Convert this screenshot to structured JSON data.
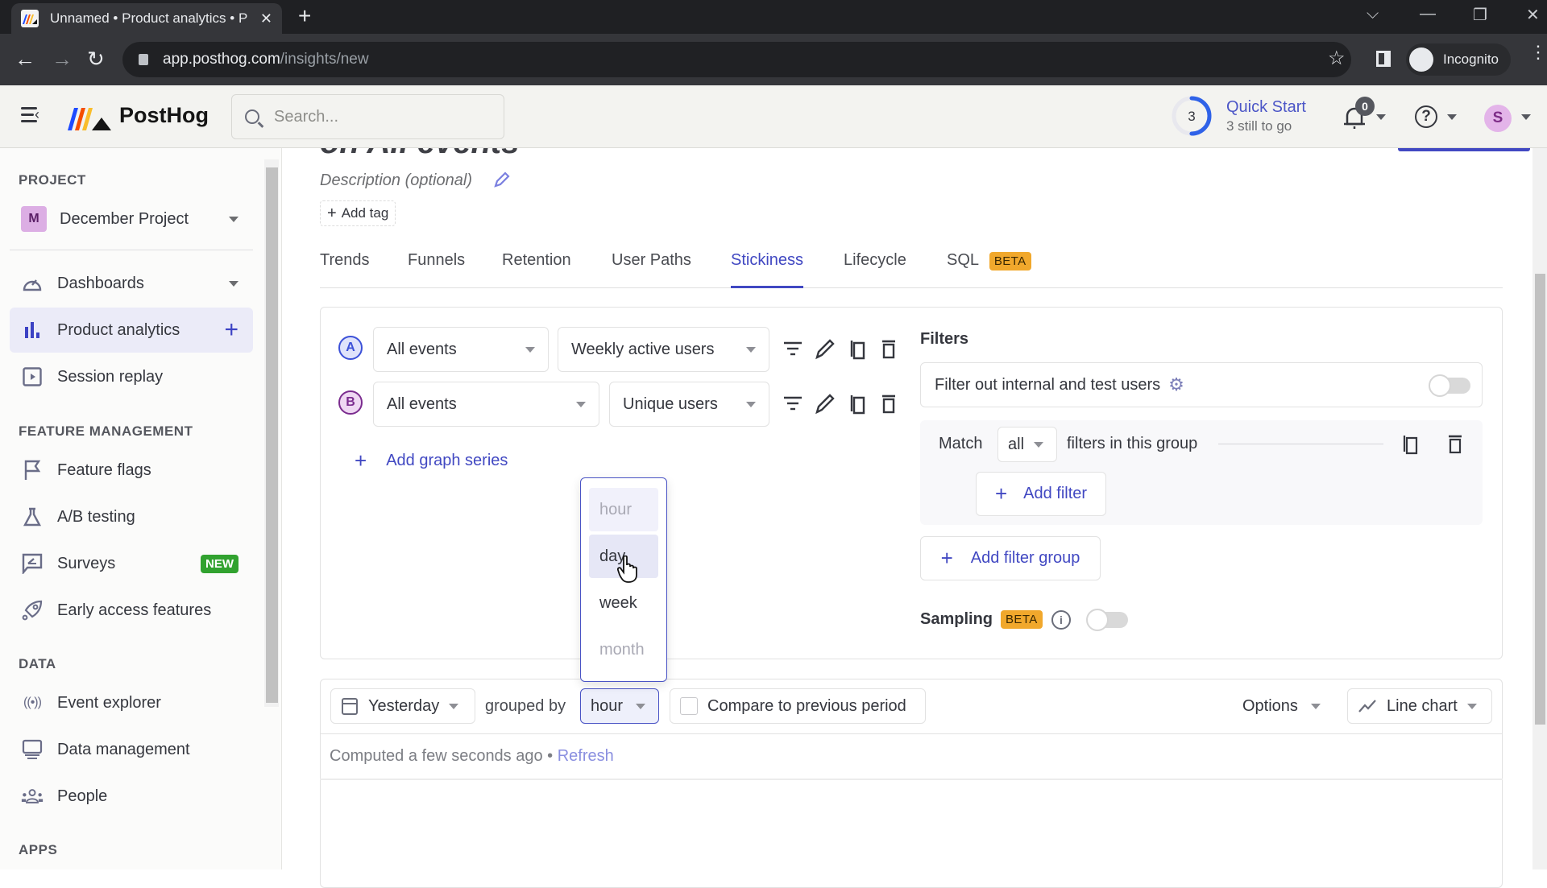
{
  "browser": {
    "tab_title": "Unnamed • Product analytics • P",
    "url_host": "app.posthog.com",
    "url_path": "/insights/new",
    "incognito_label": "Incognito"
  },
  "header": {
    "brand": "PostHog",
    "search_placeholder": "Search...",
    "quick_start": {
      "count": "3",
      "title": "Quick Start",
      "subtitle": "3 still to go",
      "progress_fraction": 0.5
    },
    "notifications_count": "0",
    "avatar_initial": "S",
    "accent_color": "#4148c2"
  },
  "sidebar": {
    "project_section": "PROJECT",
    "project": {
      "initial": "M",
      "name": "December Project"
    },
    "items_top": [
      {
        "label": "Dashboards",
        "icon": "gauge-icon",
        "has_caret": true
      },
      {
        "label": "Product analytics",
        "icon": "bar-chart-icon",
        "active": true,
        "has_plus": true
      },
      {
        "label": "Session replay",
        "icon": "play-square-icon"
      }
    ],
    "feature_section": "FEATURE MANAGEMENT",
    "feature_items": [
      {
        "label": "Feature flags",
        "icon": "flag-icon"
      },
      {
        "label": "A/B testing",
        "icon": "flask-icon"
      },
      {
        "label": "Surveys",
        "icon": "survey-icon",
        "badge": "NEW"
      },
      {
        "label": "Early access features",
        "icon": "rocket-icon"
      }
    ],
    "data_section": "DATA",
    "data_items": [
      {
        "label": "Event explorer",
        "icon": "broadcast-icon"
      },
      {
        "label": "Data management",
        "icon": "monitor-icon"
      },
      {
        "label": "People",
        "icon": "people-icon"
      }
    ],
    "apps_section": "APPS"
  },
  "insight": {
    "title": "on All events",
    "description_placeholder": "Description (optional)",
    "add_tag": "Add tag",
    "tabs": [
      {
        "label": "Trends"
      },
      {
        "label": "Funnels"
      },
      {
        "label": "Retention"
      },
      {
        "label": "User Paths"
      },
      {
        "label": "Stickiness",
        "active": true
      },
      {
        "label": "Lifecycle"
      },
      {
        "label": "SQL",
        "badge": "BETA"
      }
    ],
    "series": [
      {
        "letter": "A",
        "event": "All events",
        "math": "Weekly active users",
        "color": "#3c51d8"
      },
      {
        "letter": "B",
        "event": "All events",
        "math": "Unique users",
        "color": "#7b2c8f"
      }
    ],
    "add_series": "Add graph series",
    "filters": {
      "heading": "Filters",
      "internal_label": "Filter out internal and test users",
      "internal_enabled": false,
      "match_prefix": "Match",
      "match_value": "all",
      "match_suffix": "filters in this group",
      "add_filter": "Add filter",
      "add_filter_group": "Add filter group",
      "sampling_label": "Sampling",
      "sampling_badge": "BETA",
      "sampling_enabled": false
    },
    "date_range": "Yesterday",
    "grouped_by_label": "grouped by",
    "interval": "hour",
    "interval_options": [
      "hour",
      "day",
      "week",
      "month"
    ],
    "interval_hovered": "day",
    "compare_label": "Compare to previous period",
    "compare_checked": false,
    "options_label": "Options",
    "chart_type": "Line chart",
    "computed_text": "Computed a few seconds ago",
    "refresh_label": "Refresh"
  }
}
